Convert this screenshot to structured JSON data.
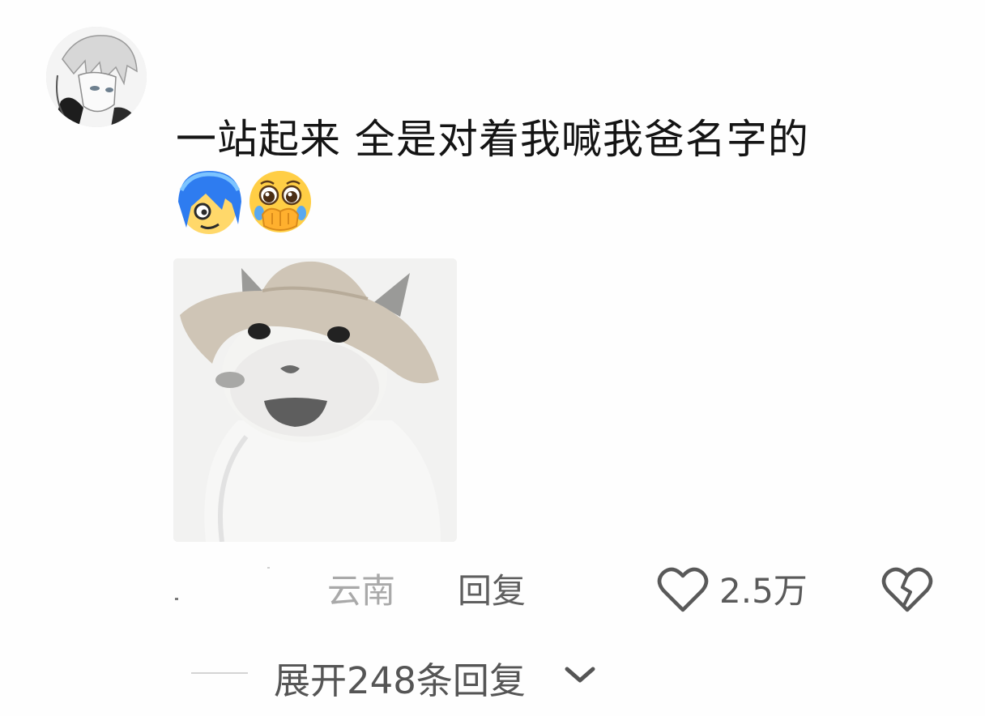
{
  "comment": {
    "text": "一站起来 全是对着我喊我爸名字的",
    "emojis": [
      "blue-hair-character-emoji",
      "pleading-face-covering-mouth-emoji"
    ],
    "sticker": "cat-wearing-hat-sticker"
  },
  "meta": {
    "location": "云南",
    "reply_label": "回复",
    "like_count": "2.5万"
  },
  "replies": {
    "expand_label": "展开248条回复"
  },
  "colors": {
    "text_primary": "#141414",
    "text_secondary": "#a9a9a9",
    "text_muted": "#5a5a5a",
    "background": "#fefefe"
  }
}
